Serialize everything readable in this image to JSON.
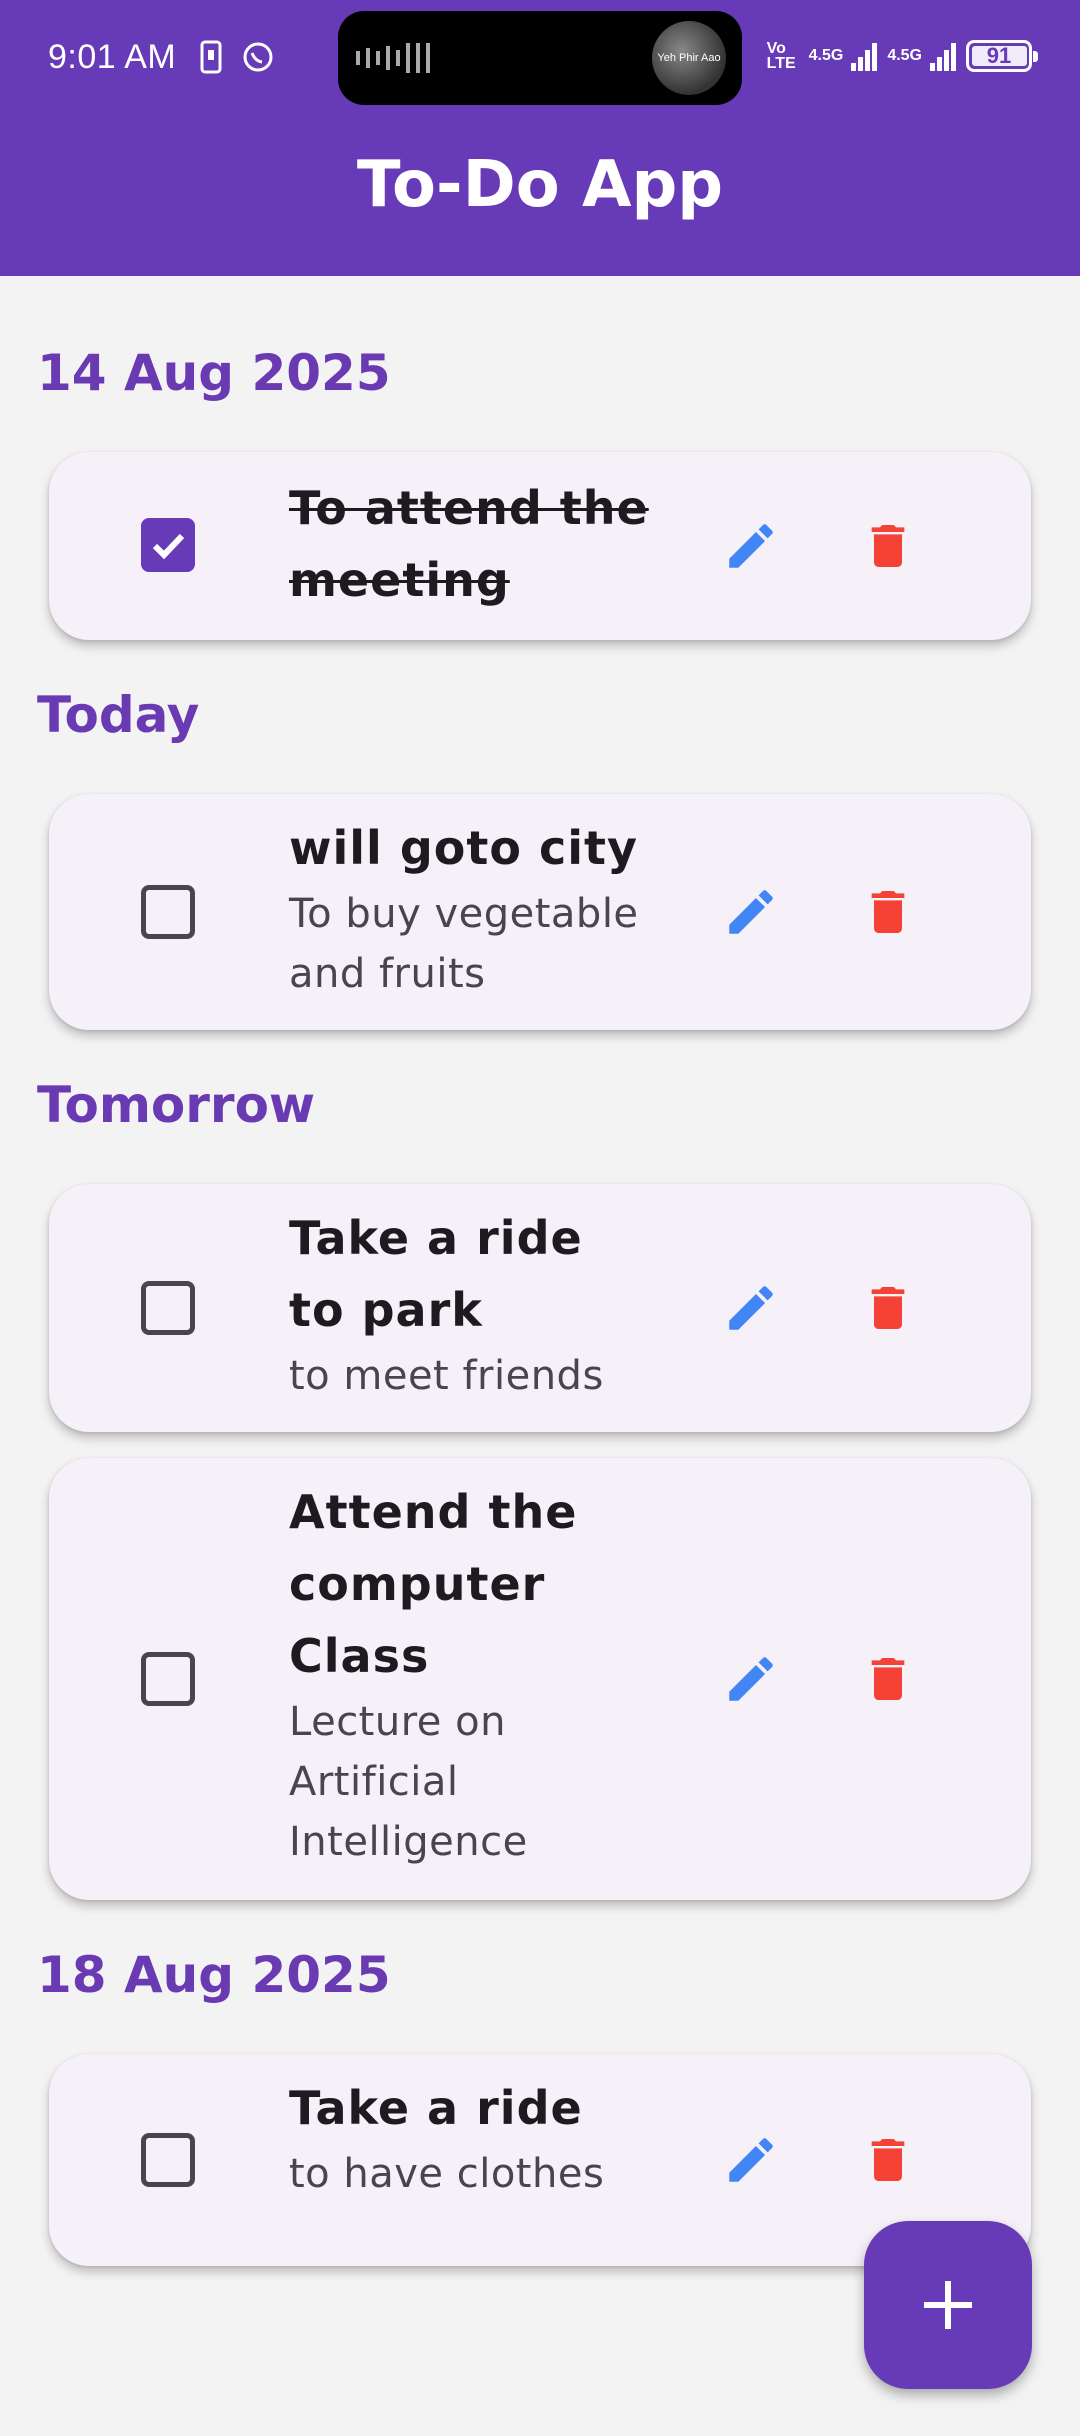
{
  "status_bar": {
    "time": "9:01 AM",
    "island_text": "Yeh Phir Aao",
    "network_1": "Vo LTE",
    "network_2": "4.5G",
    "network_3": "4.5G",
    "battery": "91"
  },
  "app_bar": {
    "title": "To-Do App"
  },
  "colors": {
    "primary": "#673ab7",
    "edit_icon": "#4285f4",
    "delete_icon": "#f44336",
    "card_bg": "#f6f1f8",
    "page_bg": "#f3f3f4"
  },
  "groups": [
    {
      "header": "14 Aug 2025",
      "tasks": [
        {
          "title": "To attend the meeting",
          "subtitle": "",
          "completed": true
        }
      ]
    },
    {
      "header": "Today",
      "tasks": [
        {
          "title": "will goto city",
          "subtitle": "To buy vegetable and fruits",
          "completed": false
        }
      ]
    },
    {
      "header": "Tomorrow",
      "tasks": [
        {
          "title": "Take a ride to park",
          "subtitle": "to meet friends",
          "completed": false
        },
        {
          "title": "Attend the computer Class",
          "subtitle": "Lecture on Artificial Intelligence",
          "completed": false
        }
      ]
    },
    {
      "header": "18 Aug 2025",
      "tasks": [
        {
          "title": "Take a ride",
          "subtitle": "to have clothes",
          "completed": false
        }
      ]
    }
  ],
  "icons": {
    "edit": "pencil-icon",
    "delete": "trash-icon",
    "add": "plus-icon",
    "check": "check-icon"
  }
}
